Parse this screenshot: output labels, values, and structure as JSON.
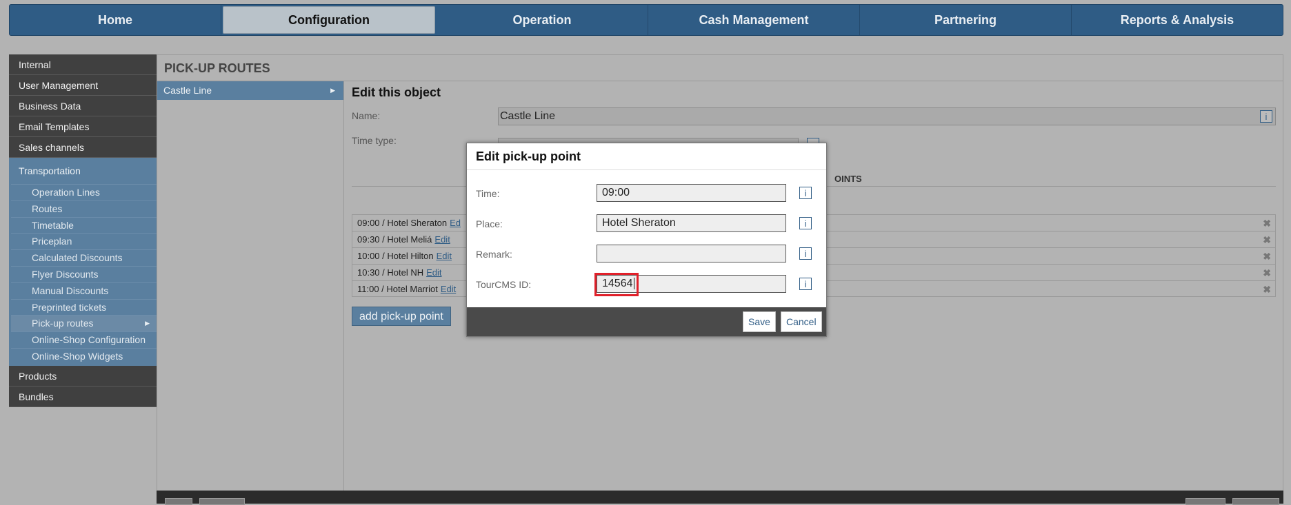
{
  "topnav": {
    "tabs": [
      {
        "label": "Home",
        "active": false
      },
      {
        "label": "Configuration",
        "active": true
      },
      {
        "label": "Operation",
        "active": false
      },
      {
        "label": "Cash Management",
        "active": false
      },
      {
        "label": "Partnering",
        "active": false
      },
      {
        "label": "Reports & Analysis",
        "active": false
      }
    ]
  },
  "sidebar": {
    "top_items": [
      "Internal",
      "User Management",
      "Business Data",
      "Email Templates",
      "Sales channels"
    ],
    "section": "Transportation",
    "sub_items": [
      "Operation Lines",
      "Routes",
      "Timetable",
      "Priceplan",
      "Calculated Discounts",
      "Flyer Discounts",
      "Manual Discounts",
      "Preprinted tickets",
      "Pick-up routes",
      "Online-Shop Configuration",
      "Online-Shop Widgets"
    ],
    "active_sub": "Pick-up routes",
    "bottom_items": [
      "Products",
      "Bundles"
    ]
  },
  "main": {
    "title": "PICK-UP ROUTES",
    "routes": [
      "Castle Line"
    ],
    "edit": {
      "title": "Edit this object",
      "name_label": "Name:",
      "name_value": "Castle Line",
      "timetype_label": "Time type:",
      "points_header": "OINTS",
      "edit_link": "Edit",
      "points": [
        {
          "label": "09:00 / Hotel Sheraton",
          "link": "Ed"
        },
        {
          "label": "09:30 / Hotel Meliá",
          "link": "Edit"
        },
        {
          "label": "10:00 / Hotel Hilton",
          "link": "Edit"
        },
        {
          "label": "10:30 / Hotel NH",
          "link": "Edit"
        },
        {
          "label": "11:00 / Hotel Marriot",
          "link": "Edit"
        }
      ],
      "add_button": "add pick-up point"
    }
  },
  "modal": {
    "title": "Edit pick-up point",
    "fields": [
      {
        "label": "Time:",
        "value": "09:00"
      },
      {
        "label": "Place:",
        "value": "Hotel Sheraton"
      },
      {
        "label": "Remark:",
        "value": ""
      },
      {
        "label": "TourCMS ID:",
        "value": "14564"
      }
    ],
    "info_glyph": "i",
    "save_label": "Save",
    "cancel_label": "Cancel"
  },
  "icons": {
    "delete": "✖",
    "arrow": "▶"
  }
}
